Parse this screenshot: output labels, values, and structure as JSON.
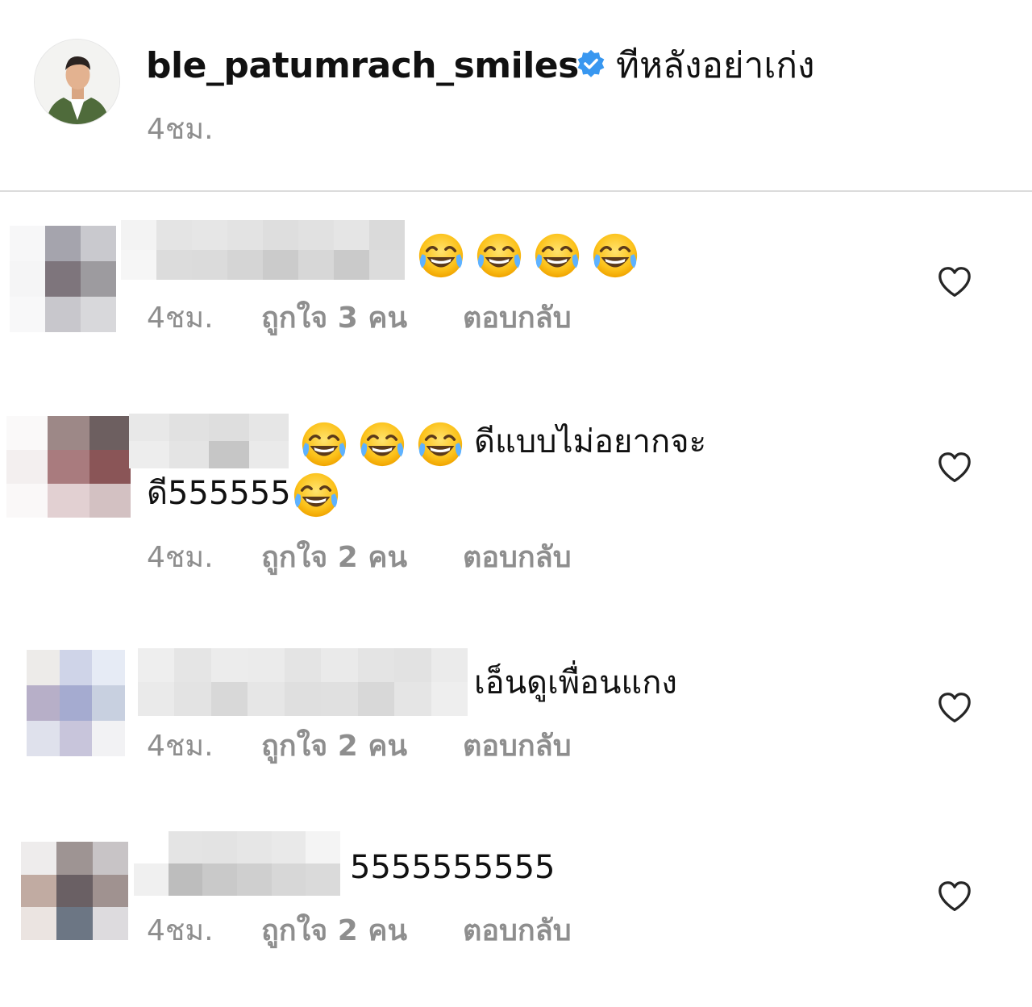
{
  "post": {
    "username": "ble_patumrach_smiles",
    "caption": "ทีหลังอย่าเก่ง",
    "time": "4ชม.",
    "verified_icon": "verified-badge-icon",
    "verified_color": "#3897f0"
  },
  "labels": {
    "reply": "ตอบกลับ",
    "heart_icon": "heart-outline-icon",
    "emoji_icon": "face-with-tears-of-joy-icon"
  },
  "comments": [
    {
      "text": "",
      "emoji_count": 4,
      "time": "4ชม.",
      "likes": "ถูกใจ 3 คน"
    },
    {
      "text": "ดีแบบไม่อยากจะ",
      "emoji_count": 3,
      "text_line2": "ดี555555",
      "emoji_count_line2": 1,
      "time": "4ชม.",
      "likes": "ถูกใจ 2 คน"
    },
    {
      "text": "เอ็นดูเพื่อนแกง",
      "emoji_count": 0,
      "time": "4ชม.",
      "likes": "ถูกใจ 2 คน"
    },
    {
      "text": "5555555555",
      "emoji_count": 0,
      "time": "4ชม.",
      "likes": "ถูกใจ 2 คน"
    }
  ]
}
